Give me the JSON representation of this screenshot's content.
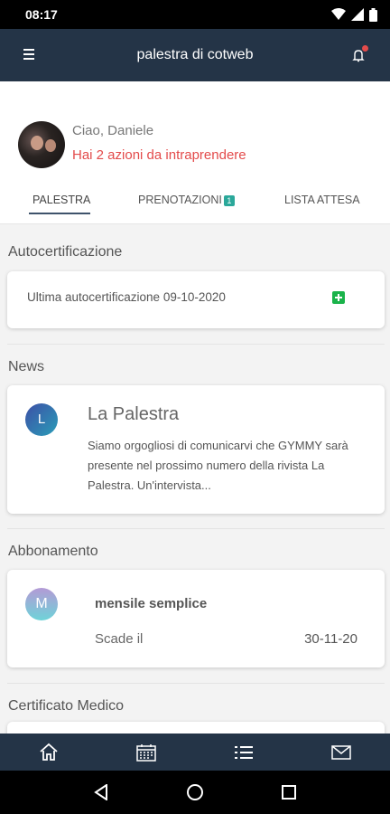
{
  "status": {
    "time": "08:17"
  },
  "header": {
    "title": "palestra di cotweb"
  },
  "profile": {
    "greeting": "Ciao, Daniele",
    "actions": "Hai 2 azioni da intraprendere"
  },
  "tabs": [
    {
      "label": "PALESTRA",
      "active": true
    },
    {
      "label": "PRENOTAZIONI",
      "badge": "1"
    },
    {
      "label": "LISTA ATTESA"
    }
  ],
  "autocert": {
    "title": "Autocertificazione",
    "text": "Ultima autocertificazione 09-10-2020"
  },
  "news": {
    "title": "News",
    "avatar_letter": "L",
    "item_title": "La Palestra",
    "item_body": "Siamo orgogliosi di comunicarvi che GYMMY sarà presente nel  prossimo numero della rivista La Palestra. Un'intervista..."
  },
  "subscription": {
    "title": "Abbonamento",
    "avatar_letter": "M",
    "name": "mensile semplice",
    "expires_label": "Scade il",
    "expires_date": "30-11-20"
  },
  "medical": {
    "title": "Certificato Medico"
  },
  "colors": {
    "primary": "#243447",
    "accent_red": "#e34b4b",
    "badge_teal": "#2ba89a",
    "plus_green": "#1ab34a"
  },
  "icons": {
    "header": [
      "menu-icon",
      "bell-icon"
    ],
    "bottom_nav": [
      "home-icon",
      "calendar-icon",
      "list-icon",
      "mail-icon"
    ],
    "system_nav": [
      "back-icon",
      "home-circle-icon",
      "recents-icon"
    ]
  }
}
